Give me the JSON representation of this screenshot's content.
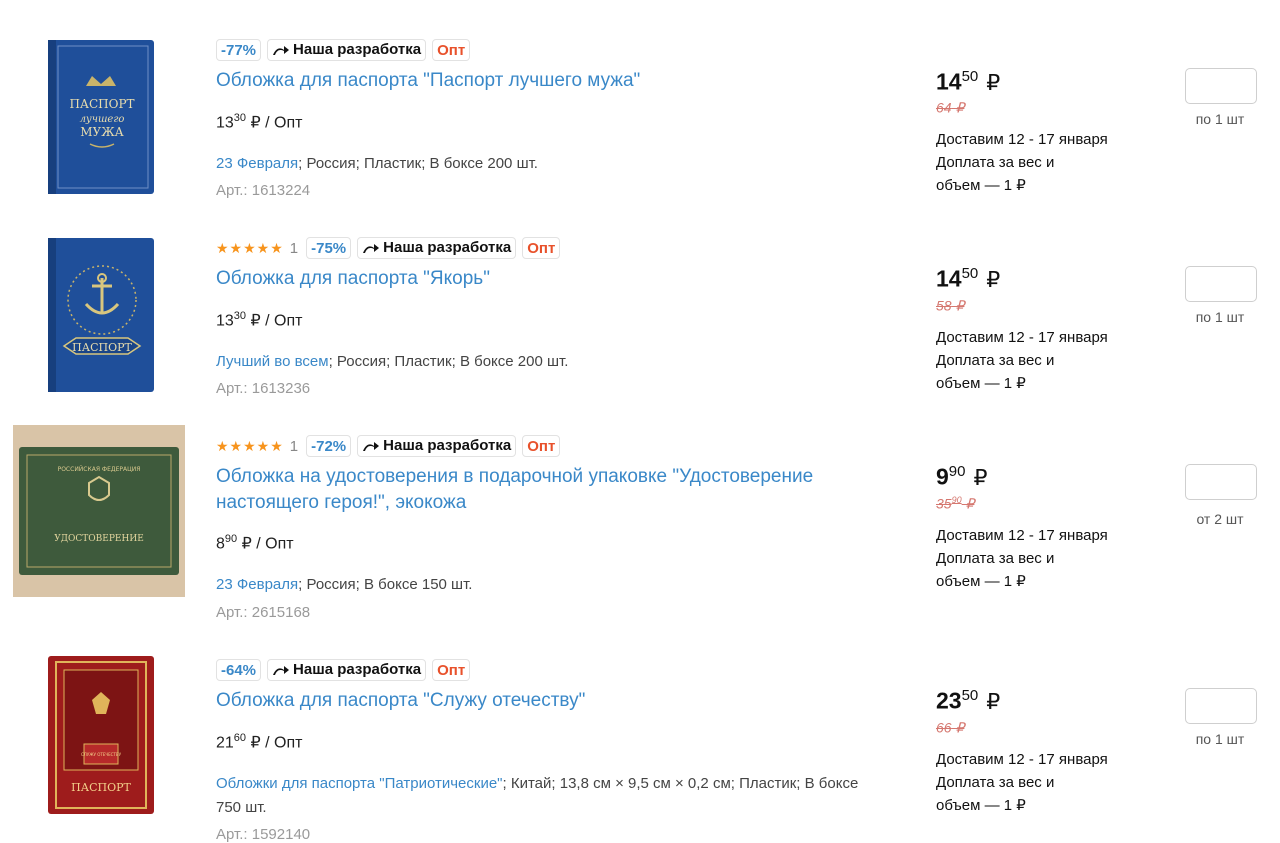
{
  "currency": "₽",
  "items": [
    {
      "show_rating": false,
      "stars": "★★★★★",
      "rating_count": "",
      "discount": "-77%",
      "own_label": "Наша разработка",
      "opt_label": "Опт",
      "title": "Обложка для паспорта \"Паспорт лучшего мужа\"",
      "opt_int": "13",
      "opt_frac": "30",
      "opt_suffix": "/ Опт",
      "props_link": "23 Февраля",
      "props_rest": "; Россия; Пластик; В боксе 200 шт.",
      "article": "Арт.: 1613224",
      "price_int": "14",
      "price_frac": "50",
      "old_int": "64",
      "old_frac": "",
      "delivery": "Доставим 12 - 17 января",
      "surcharge_1": "Доплата за вес и",
      "surcharge_2": "объем — 1 ₽",
      "qty_note": "по 1 шт"
    },
    {
      "show_rating": true,
      "stars": "★★★★★",
      "rating_count": "1",
      "discount": "-75%",
      "own_label": "Наша разработка",
      "opt_label": "Опт",
      "title": "Обложка для паспорта \"Якорь\"",
      "opt_int": "13",
      "opt_frac": "30",
      "opt_suffix": "/ Опт",
      "props_link": "Лучший во всем",
      "props_rest": "; Россия; Пластик; В боксе 200 шт.",
      "article": "Арт.: 1613236",
      "price_int": "14",
      "price_frac": "50",
      "old_int": "58",
      "old_frac": "",
      "delivery": "Доставим 12 - 17 января",
      "surcharge_1": "Доплата за вес и",
      "surcharge_2": "объем — 1 ₽",
      "qty_note": "по 1 шт"
    },
    {
      "show_rating": true,
      "stars": "★★★★★",
      "rating_count": "1",
      "discount": "-72%",
      "own_label": "Наша разработка",
      "opt_label": "Опт",
      "title": "Обложка на удостоверения в подарочной упаковке \"Удостоверение настоящего героя!\", экокожа",
      "opt_int": "8",
      "opt_frac": "90",
      "opt_suffix": "/ Опт",
      "props_link": "23 Февраля",
      "props_rest": "; Россия; В боксе 150 шт.",
      "article": "Арт.: 2615168",
      "price_int": "9",
      "price_frac": "90",
      "old_int": "35",
      "old_frac": "90",
      "delivery": "Доставим 12 - 17 января",
      "surcharge_1": "Доплата за вес и",
      "surcharge_2": "объем — 1 ₽",
      "qty_note": "от 2 шт"
    },
    {
      "show_rating": false,
      "stars": "★★★★★",
      "rating_count": "",
      "discount": "-64%",
      "own_label": "Наша разработка",
      "opt_label": "Опт",
      "title": "Обложка для паспорта \"Служу отечеству\"",
      "opt_int": "21",
      "opt_frac": "60",
      "opt_suffix": "/ Опт",
      "props_link": "Обложки для паспорта \"Патриотические\"",
      "props_rest": "; Китай; 13,8 см × 9,5 см × 0,2 см; Пластик; В боксе 750 шт.",
      "article": "Арт.: 1592140",
      "price_int": "23",
      "price_frac": "50",
      "old_int": "66",
      "old_frac": "",
      "delivery": "Доставим 12 - 17 января",
      "surcharge_1": "Доплата за вес и",
      "surcharge_2": "объем — 1 ₽",
      "qty_note": "по 1 шт"
    }
  ],
  "thumbnails": [
    {
      "lines": [
        "ПАСПОРТ",
        "лучшего",
        "МУЖА"
      ],
      "color": "#1f4f9a"
    },
    {
      "lines": [
        "ПАСПОРТ"
      ],
      "color": "#1f4f9a"
    },
    {
      "lines": [
        "РОССИЙСКАЯ ФЕДЕРАЦИЯ",
        "УДОСТОВЕРЕНИЕ"
      ],
      "color": "#3e5a3c"
    },
    {
      "lines": [
        "ПАСПОРТ",
        "СЛУЖУ ОТЕЧЕСТВУ"
      ],
      "color": "#9e1c1c"
    }
  ]
}
